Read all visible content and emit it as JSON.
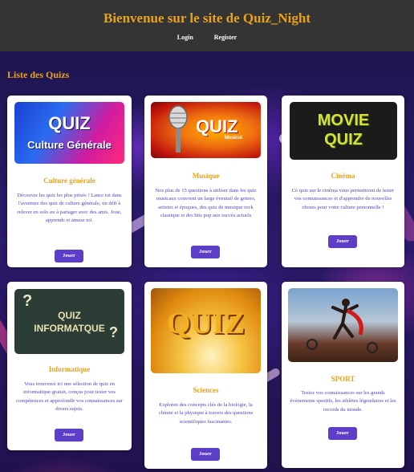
{
  "header": {
    "title": "Bienvenue sur le site de Quiz_Night",
    "nav": {
      "login": "Login",
      "register": "Register"
    }
  },
  "section_title": "Liste des Quizs",
  "thumb_text": {
    "culture_line1": "QUIZ",
    "culture_line2": "Culture Générale",
    "musique": "QUIZ",
    "musique_sub": "Musical",
    "cinema_line1": "MOVIE",
    "cinema_line2": "QUIZ",
    "info_line1": "QUIZ",
    "info_line2": "INFORMATQUE",
    "sciences": "QUIZ"
  },
  "quizzes": [
    {
      "title": "Culture générale",
      "description": "Découvre les quiz les plus prisés ! Lance toi dans l'aventure des quiz de culture générale, un défi à relever en solo ou à partager avec des amis. Joue, apprends et amuse toi.",
      "button": "Jouer"
    },
    {
      "title": "Musique",
      "description": "Nos plus de 15 questions à utiliser dans les quiz musicaux couvrent un large éventail de genres, artistes et époques, des quiz de musique rock classique et des hits pop aux succès actuels",
      "button": "Jouer"
    },
    {
      "title": "Cinéma",
      "description": "Ce quiz sur le cinéma vous permettront de tester vos connaissances et d'apprendre de nouvelles choses pour votre culture personnelle !",
      "button": "Jouer"
    },
    {
      "title": "Informatique",
      "description": "Vous trouverez ici une sélection de quiz en informatique gratuit, conçus pour tester vos compétences et approfondir vos connaissances sur divers sujets.",
      "button": "Jouer"
    },
    {
      "title": "Sciences",
      "description": "Explorez des concepts clés de la biologie, la chimie et la physique à travers des questions scientifiques fascinantes.",
      "button": "Jouer"
    },
    {
      "title": "SPORT",
      "description": "Testez vos connaissances sur les grands événements sportifs, les athlètes légendaires et les records du monde.",
      "button": "Jouer"
    }
  ]
}
